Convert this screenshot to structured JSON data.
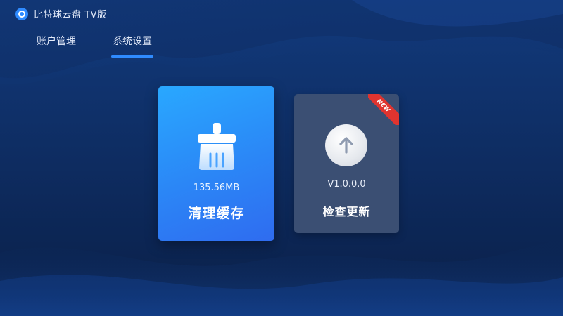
{
  "app": {
    "title": "比特球云盘 TV版",
    "icon": "cloud-logo-icon"
  },
  "tabs": [
    {
      "label": "账户管理",
      "active": false
    },
    {
      "label": "系统设置",
      "active": true
    }
  ],
  "cards": {
    "clean_cache": {
      "icon": "broom-icon",
      "size": "135.56MB",
      "label": "清理缓存"
    },
    "check_update": {
      "icon": "upload-arrow-icon",
      "version": "V1.0.0.0",
      "label": "检查更新",
      "badge": "NEW"
    }
  },
  "colors": {
    "background": "#0b2350",
    "accent": "#2f8bff",
    "clean_card": "#2b86f6",
    "update_card": "#3b4f73",
    "badge": "#e0342f"
  }
}
